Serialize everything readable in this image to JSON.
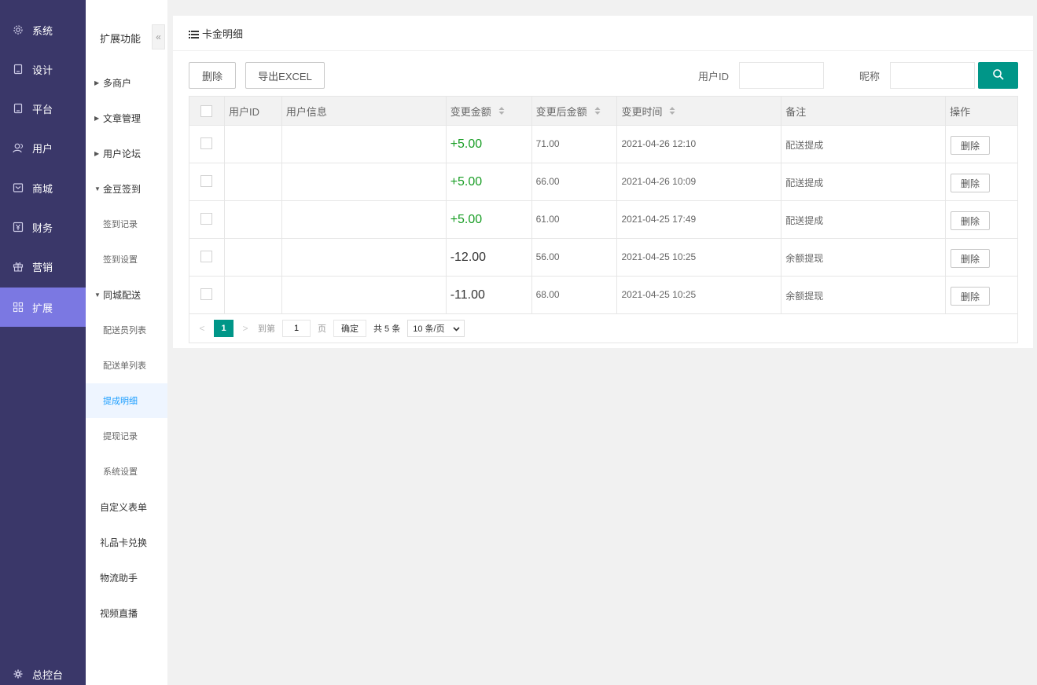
{
  "sidebar": {
    "items": [
      {
        "label": "系统",
        "icon": "gear-icon"
      },
      {
        "label": "设计",
        "icon": "tablet-icon"
      },
      {
        "label": "平台",
        "icon": "tablet-icon"
      },
      {
        "label": "用户",
        "icon": "users-icon"
      },
      {
        "label": "商城",
        "icon": "mail-icon"
      },
      {
        "label": "财务",
        "icon": "yen-icon"
      },
      {
        "label": "营销",
        "icon": "gift-icon"
      },
      {
        "label": "扩展",
        "icon": "grid-icon",
        "active": true
      }
    ],
    "bottom_label": "总控台"
  },
  "submenu": {
    "title": "扩展功能",
    "collapse_label": "«",
    "groups": [
      {
        "label": "多商户",
        "expanded": false
      },
      {
        "label": "文章管理",
        "expanded": false
      },
      {
        "label": "用户论坛",
        "expanded": false
      },
      {
        "label": "金豆签到",
        "expanded": true
      },
      {
        "label": "签到记录"
      },
      {
        "label": "签到设置"
      },
      {
        "label": "同城配送",
        "expanded": true
      },
      {
        "label": "配送员列表"
      },
      {
        "label": "配送单列表"
      },
      {
        "label": "提成明细",
        "active": true
      },
      {
        "label": "提现记录"
      },
      {
        "label": "系统设置"
      },
      {
        "label": "自定义表单"
      },
      {
        "label": "礼品卡兑换"
      },
      {
        "label": "物流助手"
      },
      {
        "label": "视频直播"
      }
    ]
  },
  "panel": {
    "title": "卡金明细",
    "toolbar": {
      "delete_label": "删除",
      "export_label": "导出EXCEL",
      "userid_label": "用户ID",
      "userid_value": "",
      "nickname_label": "昵称",
      "nickname_value": ""
    },
    "table": {
      "headers": [
        "用户ID",
        "用户信息",
        "变更金额",
        "变更后金额",
        "变更时间",
        "备注",
        "操作"
      ],
      "rows": [
        {
          "user_id": "",
          "user_info": "",
          "amount": "+5.00",
          "after": "71.00",
          "time": "2021-04-26 12:10",
          "note": "配送提成",
          "action": "删除"
        },
        {
          "user_id": "",
          "user_info": "",
          "amount": "+5.00",
          "after": "66.00",
          "time": "2021-04-26 10:09",
          "note": "配送提成",
          "action": "删除"
        },
        {
          "user_id": "",
          "user_info": "",
          "amount": "+5.00",
          "after": "61.00",
          "time": "2021-04-25 17:49",
          "note": "配送提成",
          "action": "删除"
        },
        {
          "user_id": "",
          "user_info": "",
          "amount": "-12.00",
          "after": "56.00",
          "time": "2021-04-25 10:25",
          "note": "余额提现",
          "action": "删除"
        },
        {
          "user_id": "",
          "user_info": "",
          "amount": "-11.00",
          "after": "68.00",
          "time": "2021-04-25 10:25",
          "note": "余额提现",
          "action": "删除"
        }
      ]
    },
    "pager": {
      "prev": "<",
      "current": "1",
      "next": ">",
      "goto_label": "到第",
      "goto_value": "1",
      "page_unit": "页",
      "confirm_label": "确定",
      "total_label": "共 5 条",
      "page_size": "10 条/页"
    }
  },
  "colors": {
    "sidebar_bg": "#3a3769",
    "sidebar_active": "#7b78e2",
    "accent": "#009688",
    "positive": "#1a9e26"
  }
}
